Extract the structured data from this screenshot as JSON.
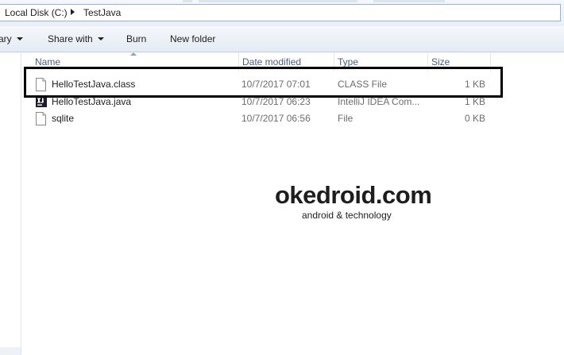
{
  "address_bar": {
    "crumbs": [
      "Local Disk (C:)",
      "TestJava"
    ]
  },
  "toolbar": {
    "library_label": "ary",
    "share_label": "Share with",
    "burn_label": "Burn",
    "new_folder_label": "New folder"
  },
  "columns": {
    "name": "Name",
    "date": "Date modified",
    "type": "Type",
    "size": "Size"
  },
  "files": [
    {
      "name": "HelloTestJava.class",
      "date": "10/7/2017 07:01",
      "type": "CLASS File",
      "size": "1 KB",
      "icon": "file-icon"
    },
    {
      "name": "HelloTestJava.java",
      "date": "10/7/2017 06:23",
      "type": "IntelliJ IDEA Com...",
      "size": "1 KB",
      "icon": "intellij-icon"
    },
    {
      "name": "sqlite",
      "date": "10/7/2017 06:56",
      "type": "File",
      "size": "0 KB",
      "icon": "file-icon"
    }
  ],
  "watermark": {
    "brand": "okedroid.com",
    "tagline": "android & technology"
  },
  "colors": {
    "highlight_border": "#000000",
    "header_text": "#4c607a"
  }
}
